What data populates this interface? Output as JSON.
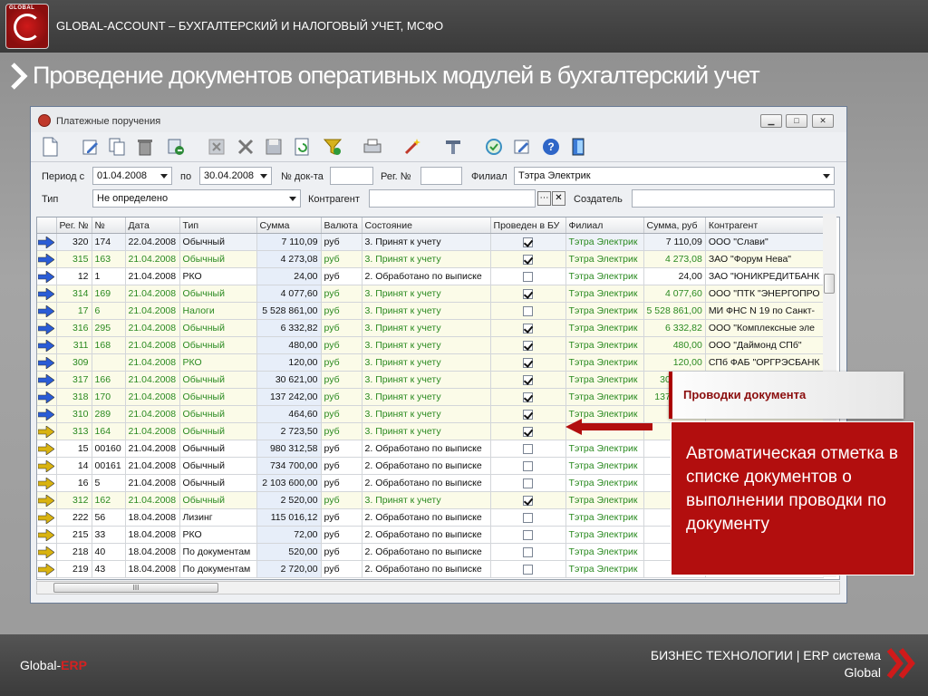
{
  "header": {
    "brand": "GLOBAL-ACCOUNT – БУХГАЛТЕРСКИЙ И НАЛОГОВЫЙ УЧЕТ, МСФО",
    "logo_text": "GLOBAL",
    "slide_title": "Проведение документов оперативных модулей в бухгалтерский учет"
  },
  "window": {
    "title": "Платежные поручения",
    "toolbar_icons": [
      "new-document-icon",
      "edit-icon",
      "copy-icon",
      "delete-icon",
      "move-icon",
      "cancel-icon",
      "close-x-icon",
      "save-icon",
      "refresh-icon",
      "filter-icon",
      "print-icon",
      "wand-icon",
      "tools-icon",
      "sync-icon",
      "note-icon",
      "help-icon",
      "exit-icon"
    ]
  },
  "filters": {
    "period_from_label": "Период с",
    "period_from": "01.04.2008",
    "period_to_label": "по",
    "period_to": "30.04.2008",
    "doc_no_label": "№ док-та",
    "doc_no": "",
    "reg_no_label": "Рег. №",
    "reg_no": "",
    "branch_label": "Филиал",
    "branch": "Тэтра Электрик",
    "type_label": "Тип",
    "type": "Не определено",
    "counterparty_label": "Контрагент",
    "counterparty": "",
    "creator_label": "Создатель",
    "creator": ""
  },
  "grid": {
    "columns": [
      "",
      "Рег. №",
      "№",
      "Дата",
      "Тип",
      "Сумма",
      "Валюта",
      "Состояние",
      "Проведен в БУ",
      "Филиал",
      "Сумма, руб",
      "Контрагент"
    ],
    "rows": [
      {
        "arrow": "blue",
        "style": "bl",
        "reg": "320",
        "no": "174",
        "date": "22.04.2008",
        "type": "Обычный",
        "sum": "7 110,09",
        "cur": "руб",
        "state": "3. Принят к учету",
        "posted": true,
        "branch": "Тэтра Электрик",
        "sumrub": "7 110,09",
        "cp": "ООО \"Слави\""
      },
      {
        "arrow": "blue",
        "style": "gr",
        "reg": "315",
        "no": "163",
        "date": "21.04.2008",
        "type": "Обычный",
        "sum": "4 273,08",
        "cur": "руб",
        "state": "3. Принят к учету",
        "posted": true,
        "branch": "Тэтра Электрик",
        "sumrub": "4 273,08",
        "cp": "ЗАО \"Форум Нева\""
      },
      {
        "arrow": "blue",
        "style": "wh",
        "reg": "12",
        "no": "1",
        "date": "21.04.2008",
        "type": "РКО",
        "sum": "24,00",
        "cur": "руб",
        "state": "2. Обработано по выписке",
        "posted": false,
        "branch": "Тэтра Электрик",
        "sumrub": "24,00",
        "cp": "ЗАО \"ЮНИКРЕДИТБАНК"
      },
      {
        "arrow": "blue",
        "style": "gr",
        "reg": "314",
        "no": "169",
        "date": "21.04.2008",
        "type": "Обычный",
        "sum": "4 077,60",
        "cur": "руб",
        "state": "3. Принят к учету",
        "posted": true,
        "branch": "Тэтра Электрик",
        "sumrub": "4 077,60",
        "cp": "ООО \"ПТК \"ЭНЕРГОПРО"
      },
      {
        "arrow": "blue",
        "style": "gr",
        "reg": "17",
        "no": "6",
        "date": "21.04.2008",
        "type": "Налоги",
        "sum": "5 528 861,00",
        "cur": "руб",
        "state": "3. Принят к учету",
        "posted": false,
        "branch": "Тэтра Электрик",
        "sumrub": "5 528 861,00",
        "cp": "МИ ФНС N 19 по Санкт-"
      },
      {
        "arrow": "blue",
        "style": "gr",
        "reg": "316",
        "no": "295",
        "date": "21.04.2008",
        "type": "Обычный",
        "sum": "6 332,82",
        "cur": "руб",
        "state": "3. Принят к учету",
        "posted": true,
        "branch": "Тэтра Электрик",
        "sumrub": "6 332,82",
        "cp": "ООО \"Комплексные эле"
      },
      {
        "arrow": "blue",
        "style": "gr",
        "reg": "311",
        "no": "168",
        "date": "21.04.2008",
        "type": "Обычный",
        "sum": "480,00",
        "cur": "руб",
        "state": "3. Принят к учету",
        "posted": true,
        "branch": "Тэтра Электрик",
        "sumrub": "480,00",
        "cp": "ООО \"Даймонд СПб\""
      },
      {
        "arrow": "blue",
        "style": "gr",
        "reg": "309",
        "no": "",
        "date": "21.04.2008",
        "type": "РКО",
        "sum": "120,00",
        "cur": "руб",
        "state": "3. Принят к учету",
        "posted": true,
        "branch": "Тэтра Электрик",
        "sumrub": "120,00",
        "cp": "СПб ФАБ \"ОРГРЭСБАНК"
      },
      {
        "arrow": "blue",
        "style": "gr",
        "reg": "317",
        "no": "166",
        "date": "21.04.2008",
        "type": "Обычный",
        "sum": "30 621,00",
        "cur": "руб",
        "state": "3. Принят к учету",
        "posted": true,
        "branch": "Тэтра Электрик",
        "sumrub": "30 621,00",
        "cp": "ООО \"К"
      },
      {
        "arrow": "blue",
        "style": "gr",
        "reg": "318",
        "no": "170",
        "date": "21.04.2008",
        "type": "Обычный",
        "sum": "137 242,00",
        "cur": "руб",
        "state": "3. Принят к учету",
        "posted": true,
        "branch": "Тэтра Электрик",
        "sumrub": "137 242,00",
        "cp": ""
      },
      {
        "arrow": "blue",
        "style": "gr",
        "reg": "310",
        "no": "289",
        "date": "21.04.2008",
        "type": "Обычный",
        "sum": "464,60",
        "cur": "руб",
        "state": "3. Принят к учету",
        "posted": true,
        "branch": "Тэтра Электрик",
        "sumrub": "",
        "cp": ""
      },
      {
        "arrow": "yellow",
        "style": "gr",
        "reg": "313",
        "no": "164",
        "date": "21.04.2008",
        "type": "Обычный",
        "sum": "2 723,50",
        "cur": "руб",
        "state": "3. Принят к учету",
        "posted": true,
        "branch": "",
        "sumrub": "",
        "cp": ""
      },
      {
        "arrow": "yellow",
        "style": "wh",
        "reg": "15",
        "no": "00160",
        "date": "21.04.2008",
        "type": "Обычный",
        "sum": "980 312,58",
        "cur": "руб",
        "state": "2. Обработано по выписке",
        "posted": false,
        "branch": "Тэтра Электрик",
        "sumrub": "980",
        "cp": ""
      },
      {
        "arrow": "yellow",
        "style": "wh",
        "reg": "14",
        "no": "00161",
        "date": "21.04.2008",
        "type": "Обычный",
        "sum": "734 700,00",
        "cur": "руб",
        "state": "2. Обработано по выписке",
        "posted": false,
        "branch": "Тэтра Электрик",
        "sumrub": "734",
        "cp": ""
      },
      {
        "arrow": "yellow",
        "style": "wh",
        "reg": "16",
        "no": "5",
        "date": "21.04.2008",
        "type": "Обычный",
        "sum": "2 103 600,00",
        "cur": "руб",
        "state": "2. Обработано по выписке",
        "posted": false,
        "branch": "Тэтра Электрик",
        "sumrub": "2 103",
        "cp": ""
      },
      {
        "arrow": "yellow",
        "style": "gr",
        "reg": "312",
        "no": "162",
        "date": "21.04.2008",
        "type": "Обычный",
        "sum": "2 520,00",
        "cur": "руб",
        "state": "3. Принят к учету",
        "posted": true,
        "branch": "Тэтра Электрик",
        "sumrub": "2",
        "cp": ""
      },
      {
        "arrow": "yellow",
        "style": "wh",
        "reg": "222",
        "no": "56",
        "date": "18.04.2008",
        "type": "Лизинг",
        "sum": "115 016,12",
        "cur": "руб",
        "state": "2. Обработано по выписке",
        "posted": false,
        "branch": "Тэтра Электрик",
        "sumrub": "115",
        "cp": ""
      },
      {
        "arrow": "yellow",
        "style": "wh",
        "reg": "215",
        "no": "33",
        "date": "18.04.2008",
        "type": "РКО",
        "sum": "72,00",
        "cur": "руб",
        "state": "2. Обработано по выписке",
        "posted": false,
        "branch": "Тэтра Электрик",
        "sumrub": "",
        "cp": ""
      },
      {
        "arrow": "yellow",
        "style": "wh",
        "reg": "218",
        "no": "40",
        "date": "18.04.2008",
        "type": "По документам",
        "sum": "520,00",
        "cur": "руб",
        "state": "2. Обработано по выписке",
        "posted": false,
        "branch": "Тэтра Электрик",
        "sumrub": "",
        "cp": ""
      },
      {
        "arrow": "yellow",
        "style": "wh",
        "reg": "219",
        "no": "43",
        "date": "18.04.2008",
        "type": "По документам",
        "sum": "2 720,00",
        "cur": "руб",
        "state": "2. Обработано по выписке",
        "posted": false,
        "branch": "Тэтра Электрик",
        "sumrub": "2",
        "cp": ""
      }
    ],
    "hscroll_label": "III"
  },
  "callouts": {
    "title": "Проводки документа",
    "body": "Автоматическая отметка в списке документов о выполнении проводки по документу"
  },
  "footer": {
    "left_prefix": "Global-",
    "left_accent": "ERP",
    "right_line1": "БИЗНЕС ТЕХНОЛОГИИ | ERP система",
    "right_line2": "Global"
  },
  "colors": {
    "accent_red": "#b20e0e",
    "posted_green": "#2a8a20"
  }
}
